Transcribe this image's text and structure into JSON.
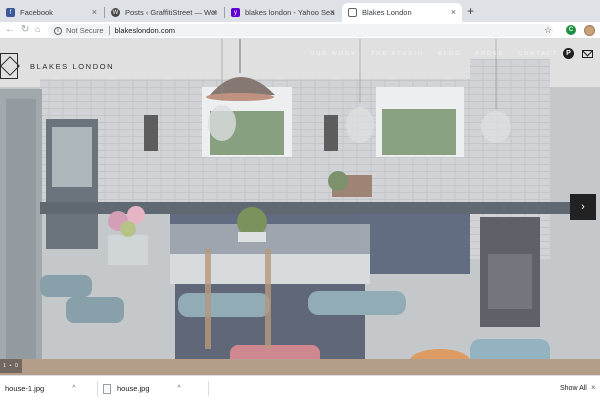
{
  "browser": {
    "tabs": [
      {
        "title": "Facebook",
        "favicon": "facebook-icon",
        "active": false
      },
      {
        "title": "Posts ‹ GraffitiStreet — WordP",
        "favicon": "wordpress-icon",
        "active": false
      },
      {
        "title": "blakes london - Yahoo Search R",
        "favicon": "yahoo-icon",
        "active": false
      },
      {
        "title": "Blakes London",
        "favicon": "page-icon",
        "active": true
      }
    ],
    "new_tab": "+",
    "close_glyph": "×",
    "address": {
      "security": "Not Secure",
      "url": "blakeslondon.com"
    },
    "extension_letter": "C"
  },
  "site": {
    "brand": "BLAKES LONDON",
    "nav": [
      "OUR WORK",
      "THE STUDIO",
      "BLOG",
      "PRESS",
      "CONTACT"
    ],
    "social": [
      "pinterest-icon",
      "mail-icon"
    ],
    "pinterest_glyph": "P",
    "next_arrow": "›",
    "slide_counter": "1 • 0"
  },
  "downloads": {
    "items": [
      {
        "name": "house-1.jpg"
      },
      {
        "name": "house.jpg"
      }
    ],
    "show_all": "Show All",
    "caret": "^",
    "close": "×"
  },
  "colors": {
    "facebook": "#3b5998",
    "wordpress": "#464646",
    "yahoo": "#6001d2",
    "chrome_bg": "#dee1e6"
  }
}
